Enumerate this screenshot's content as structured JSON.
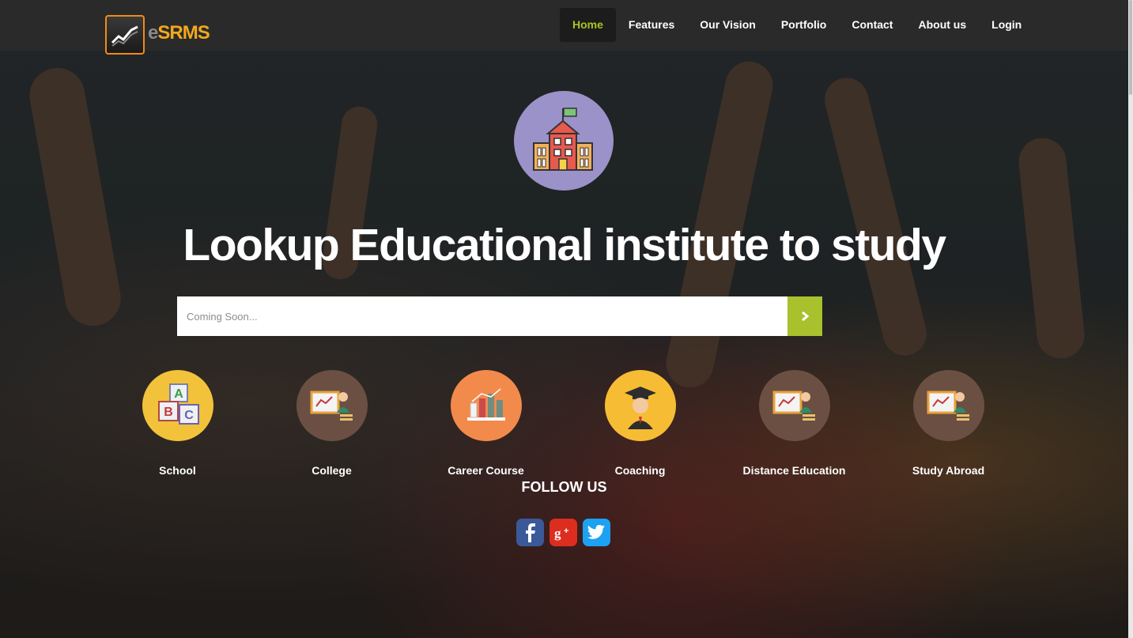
{
  "brand": {
    "prefix": "e",
    "name": "SRMS",
    "icon": "chart-trend-icon"
  },
  "nav": {
    "items": [
      {
        "label": "Home",
        "active": true
      },
      {
        "label": "Features"
      },
      {
        "label": "Our Vision"
      },
      {
        "label": "Portfolio"
      },
      {
        "label": "Contact"
      },
      {
        "label": "About us"
      },
      {
        "label": "Login"
      }
    ]
  },
  "hero": {
    "title": "Lookup Educational institute to study",
    "logo_icon": "school-building-icon"
  },
  "search": {
    "placeholder": "Coming Soon...",
    "button_icon": "chevron-right-icon"
  },
  "categories": [
    {
      "label": "School",
      "icon": "abc-blocks-icon",
      "color": "#f2c23a"
    },
    {
      "label": "College",
      "icon": "teacher-board-icon",
      "color": "#6b4f43"
    },
    {
      "label": "Career Course",
      "icon": "bar-chart-icon",
      "color": "#f28a4c"
    },
    {
      "label": "Coaching",
      "icon": "graduate-icon",
      "color": "#f6bd34"
    },
    {
      "label": "Distance Education",
      "icon": "teacher-board-icon",
      "color": "#6b4f43"
    },
    {
      "label": "Study Abroad",
      "icon": "teacher-board-icon",
      "color": "#6b4f43"
    }
  ],
  "follow": {
    "title": "FOLLOW US",
    "networks": [
      {
        "icon": "facebook-icon",
        "glyph": "f",
        "color": "#3b5998"
      },
      {
        "icon": "google-plus-icon",
        "glyph": "g+",
        "color": "#dd2d1f"
      },
      {
        "icon": "twitter-icon",
        "glyph": "t",
        "color": "#1da1f2"
      }
    ]
  },
  "colors": {
    "accent": "#a8c12d",
    "navbar": "#2a2a2a",
    "brand_orange": "#f2a81d"
  }
}
